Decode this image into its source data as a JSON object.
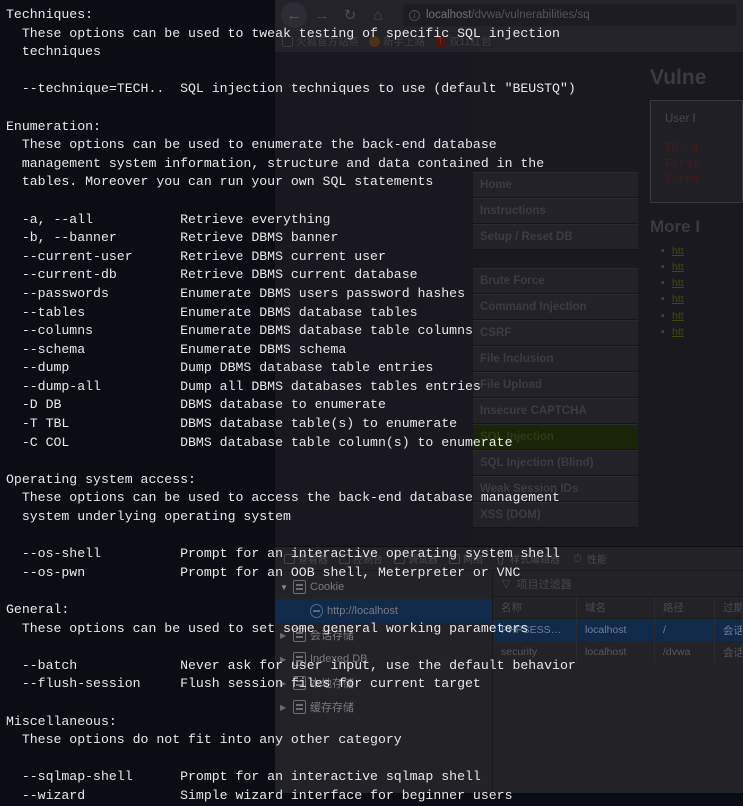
{
  "browser": {
    "nav": {
      "back_icon": "arrow-left-icon",
      "forward_icon": "arrow-right-icon",
      "reload_icon": "reload-icon",
      "home_icon": "home-icon"
    },
    "url": {
      "info_icon": "info-circle-icon",
      "host": "localhost",
      "path": "/dvwa/vulnerabilities/sq"
    },
    "bookmarks": [
      {
        "label": "火狐官方站点",
        "icon": "bookmark-page-icon"
      },
      {
        "label": "新手上路",
        "icon": "firefox-icon"
      },
      {
        "label": "双11红包",
        "icon": "taobao-icon"
      }
    ]
  },
  "dvwa": {
    "menu": [
      {
        "label": "Home",
        "active": false
      },
      {
        "label": "Instructions",
        "active": false
      },
      {
        "label": "Setup / Reset DB",
        "active": false
      },
      {
        "label": "Brute Force",
        "active": false
      },
      {
        "label": "Command Injection",
        "active": false
      },
      {
        "label": "CSRF",
        "active": false
      },
      {
        "label": "File Inclusion",
        "active": false
      },
      {
        "label": "File Upload",
        "active": false
      },
      {
        "label": "Insecure CAPTCHA",
        "active": false
      },
      {
        "label": "SQL Injection",
        "active": true
      },
      {
        "label": "SQL Injection (Blind)",
        "active": false
      },
      {
        "label": "Weak Session IDs",
        "active": false
      },
      {
        "label": "XSS (DOM)",
        "active": false
      }
    ],
    "heading": "Vulne",
    "form_label": "User I",
    "result_lines": [
      "ID: 1",
      "First",
      "Surna"
    ],
    "more_heading": "More I",
    "links": [
      "htt",
      "htt",
      "htt",
      "htt",
      "htt",
      "htt"
    ]
  },
  "devtools": {
    "tabs": [
      {
        "label": "查看器",
        "icon": "inspector-icon"
      },
      {
        "label": "控制台",
        "icon": "console-icon"
      },
      {
        "label": "调试器",
        "icon": "debugger-icon"
      },
      {
        "label": "网络",
        "icon": "network-icon"
      },
      {
        "label": "样式编辑器",
        "icon": "braces-icon"
      },
      {
        "label": "性能",
        "icon": "performance-icon"
      }
    ],
    "tree": [
      {
        "label": "Cookie",
        "depth": 0,
        "expanded": true,
        "selected": false,
        "icon": "storage-icon"
      },
      {
        "label": "http://localhost",
        "depth": 1,
        "expanded": false,
        "selected": true,
        "icon": "globe-icon"
      },
      {
        "label": "会话存储",
        "depth": 0,
        "expanded": false,
        "selected": false,
        "icon": "storage-icon"
      },
      {
        "label": "Indexed DB",
        "depth": 0,
        "expanded": false,
        "selected": false,
        "icon": "storage-icon"
      },
      {
        "label": "本地存储",
        "depth": 0,
        "expanded": false,
        "selected": false,
        "icon": "storage-icon"
      },
      {
        "label": "缓存存储",
        "depth": 0,
        "expanded": false,
        "selected": false,
        "icon": "storage-icon"
      }
    ],
    "filter_placeholder": "项目过滤器",
    "filter_icon": "funnel-icon",
    "columns": [
      "名称",
      "域名",
      "路径",
      "过期时间"
    ],
    "rows": [
      {
        "name": "PHPSESS…",
        "domain": "localhost",
        "path": "/",
        "expiry": "会话",
        "selected": true
      },
      {
        "name": "security",
        "domain": "localhost",
        "path": "/dvwa",
        "expiry": "会话",
        "selected": false
      }
    ]
  },
  "terminal": {
    "lines": [
      "Techniques:",
      "  These options can be used to tweak testing of specific SQL injection",
      "  techniques",
      "",
      "  --technique=TECH..  SQL injection techniques to use (default \"BEUSTQ\")",
      "",
      "Enumeration:",
      "  These options can be used to enumerate the back-end database",
      "  management system information, structure and data contained in the",
      "  tables. Moreover you can run your own SQL statements",
      "",
      "  -a, --all           Retrieve everything",
      "  -b, --banner        Retrieve DBMS banner",
      "  --current-user      Retrieve DBMS current user",
      "  --current-db        Retrieve DBMS current database",
      "  --passwords         Enumerate DBMS users password hashes",
      "  --tables            Enumerate DBMS database tables",
      "  --columns           Enumerate DBMS database table columns",
      "  --schema            Enumerate DBMS schema",
      "  --dump              Dump DBMS database table entries",
      "  --dump-all          Dump all DBMS databases tables entries",
      "  -D DB               DBMS database to enumerate",
      "  -T TBL              DBMS database table(s) to enumerate",
      "  -C COL              DBMS database table column(s) to enumerate",
      "",
      "Operating system access:",
      "  These options can be used to access the back-end database management",
      "  system underlying operating system",
      "",
      "  --os-shell          Prompt for an interactive operating system shell",
      "  --os-pwn            Prompt for an OOB shell, Meterpreter or VNC",
      "",
      "General:",
      "  These options can be used to set some general working parameters",
      "",
      "  --batch             Never ask for user input, use the default behavior",
      "  --flush-session     Flush session files for current target",
      "",
      "Miscellaneous:",
      "  These options do not fit into any other category",
      "",
      "  --sqlmap-shell      Prompt for an interactive sqlmap shell",
      "  --wizard            Simple wizard interface for beginner users"
    ]
  }
}
